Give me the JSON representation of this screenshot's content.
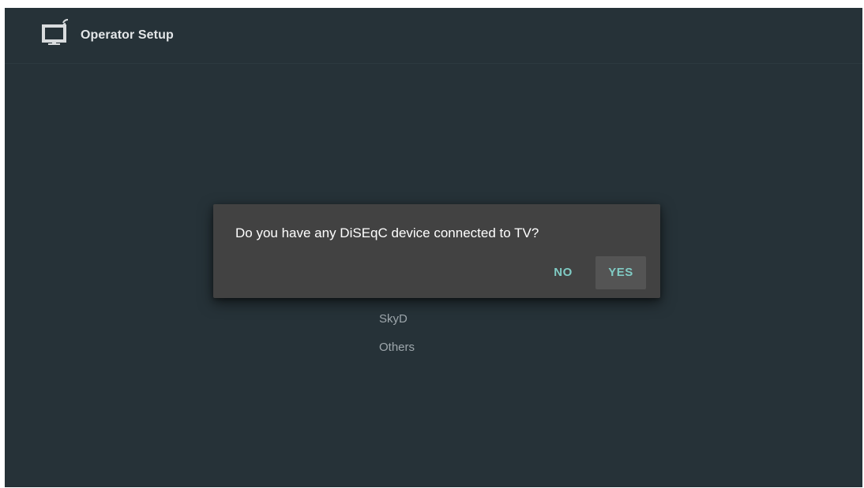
{
  "header": {
    "title": "Operator Setup",
    "icon": "tv-satellite-icon"
  },
  "operator_list": {
    "items": [
      {
        "label": "SkyD"
      },
      {
        "label": "Others"
      }
    ]
  },
  "dialog": {
    "message": "Do you have any DiSEqC device connected to TV?",
    "no_label": "NO",
    "yes_label": "YES",
    "focused_button": "YES"
  },
  "colors": {
    "background": "#263238",
    "dialog_background": "#424242",
    "accent": "#80cbc4",
    "focused_button_bg": "#545454"
  }
}
